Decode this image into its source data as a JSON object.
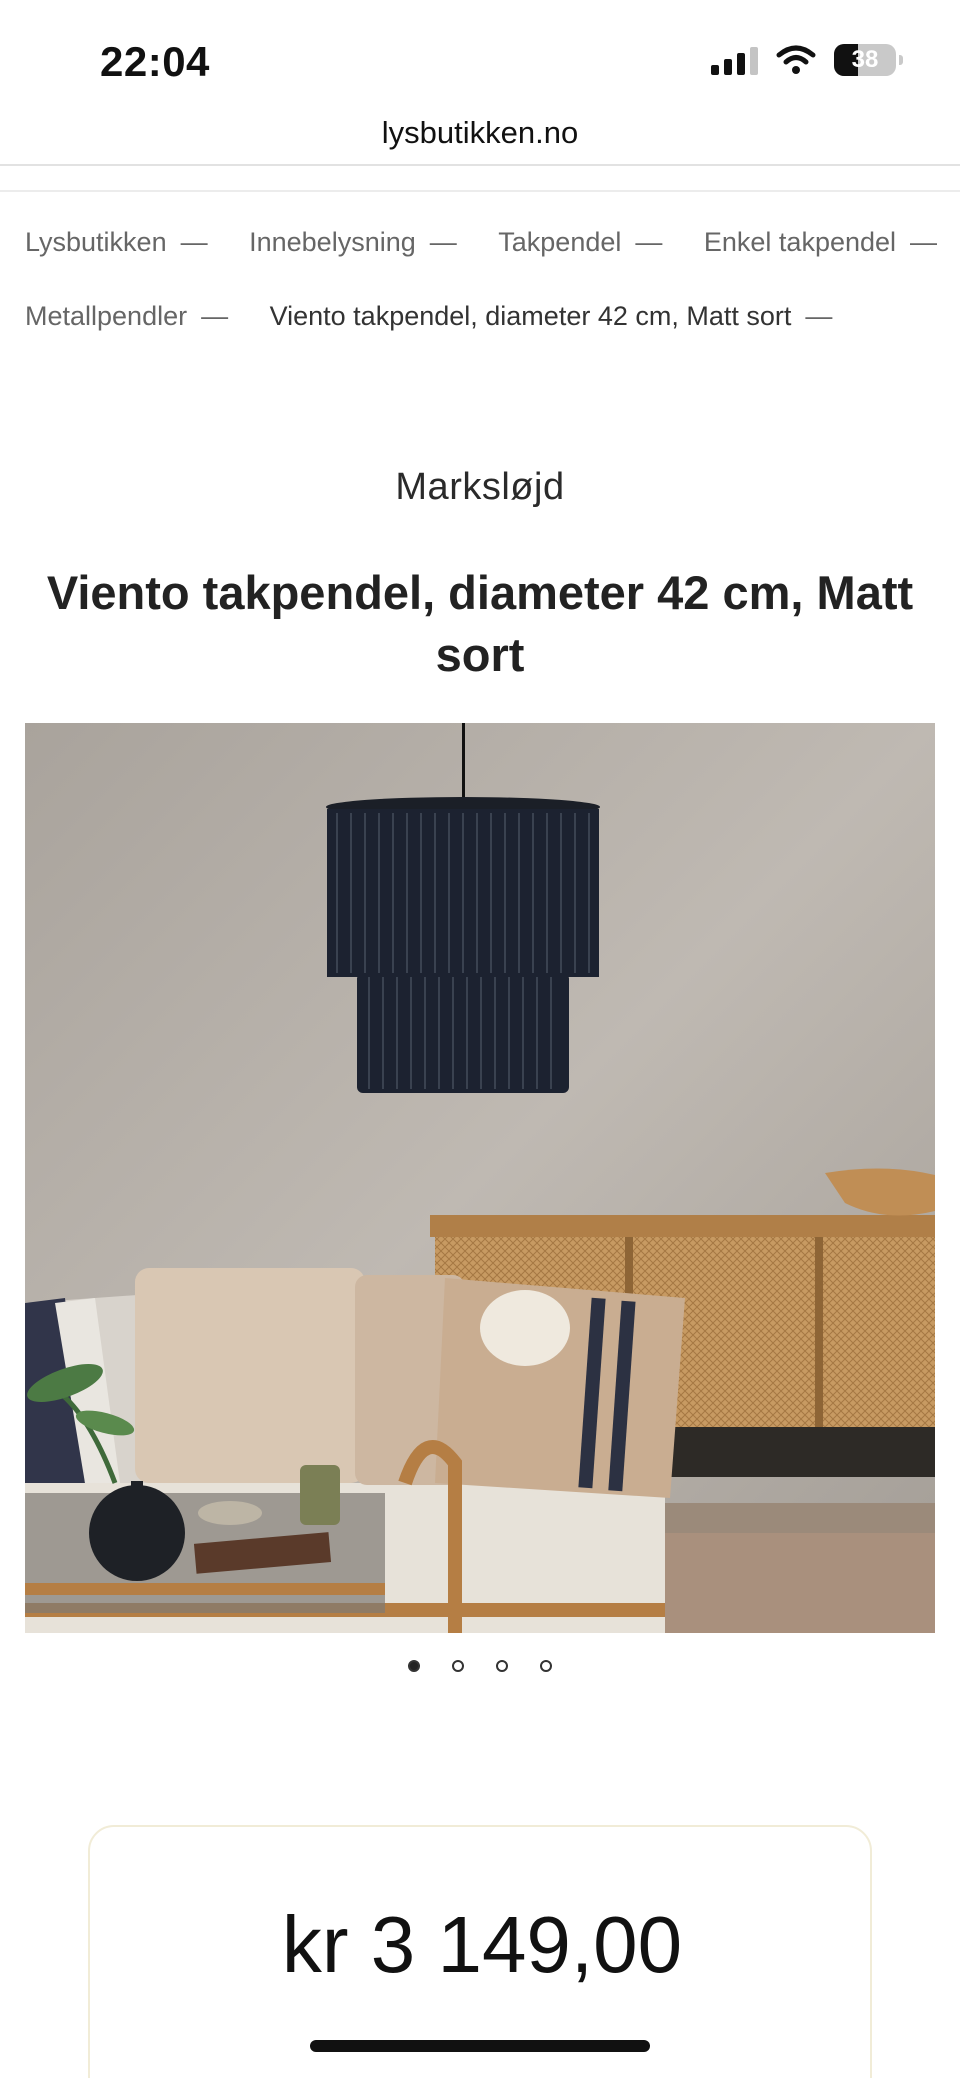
{
  "status_bar": {
    "time": "22:04",
    "battery": "38",
    "battery_level": 0.38,
    "icons": [
      "signal-icon",
      "wifi-icon",
      "battery-icon"
    ]
  },
  "browser": {
    "url": "lysbutikken.no"
  },
  "breadcrumb": {
    "items": [
      {
        "label": "Lysbutikken"
      },
      {
        "label": "Innebelysning"
      },
      {
        "label": "Takpendel"
      },
      {
        "label": "Enkel takpendel"
      },
      {
        "label": "Metallpendler"
      },
      {
        "label": "Viento takpendel, diameter 42 cm, Matt sort"
      }
    ],
    "separator": "—"
  },
  "product": {
    "brand": "Marksløjd",
    "title": "Viento takpendel, diameter 42 cm, Matt sort",
    "price": "kr 3 149,00"
  },
  "carousel": {
    "total": 4,
    "active_index": 0
  }
}
